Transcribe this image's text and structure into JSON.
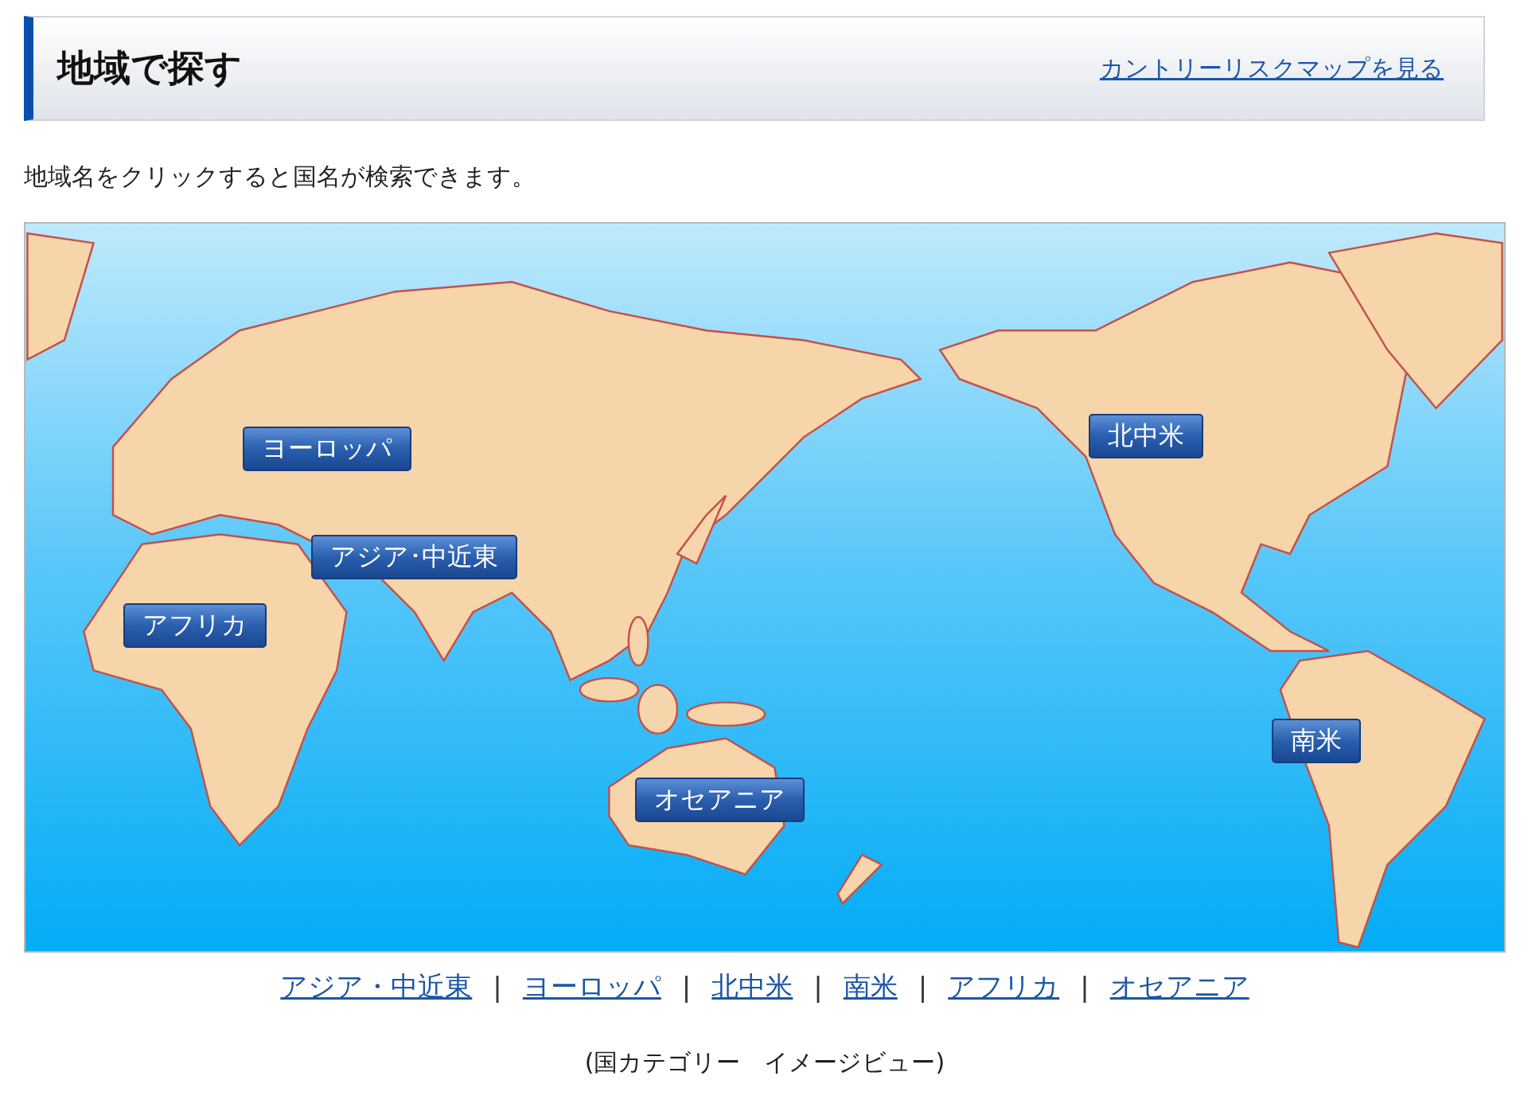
{
  "section_header": {
    "title": "地域で探す",
    "link": "カントリーリスクマップを見る"
  },
  "instruction": "地域名をクリックすると国名が検索できます。",
  "map": {
    "region_buttons": [
      {
        "kind": "europe",
        "label": "ヨーロッパ"
      },
      {
        "kind": "asia",
        "label": "アジア･中近東"
      },
      {
        "kind": "africa",
        "label": "アフリカ"
      },
      {
        "kind": "north_america",
        "label": "北中米"
      },
      {
        "kind": "south_america",
        "label": "南米"
      },
      {
        "kind": "oceania",
        "label": "オセアニア"
      }
    ]
  },
  "region_links": [
    {
      "label": "アジア・中近東"
    },
    {
      "label": "ヨーロッパ"
    },
    {
      "label": "北中米"
    },
    {
      "label": "南米"
    },
    {
      "label": "アフリカ"
    },
    {
      "label": "オセアニア"
    }
  ],
  "link_separators": [
    "|",
    "|",
    "|",
    "|",
    "|"
  ],
  "caption": "(国カテゴリー　イメージビュー)"
}
